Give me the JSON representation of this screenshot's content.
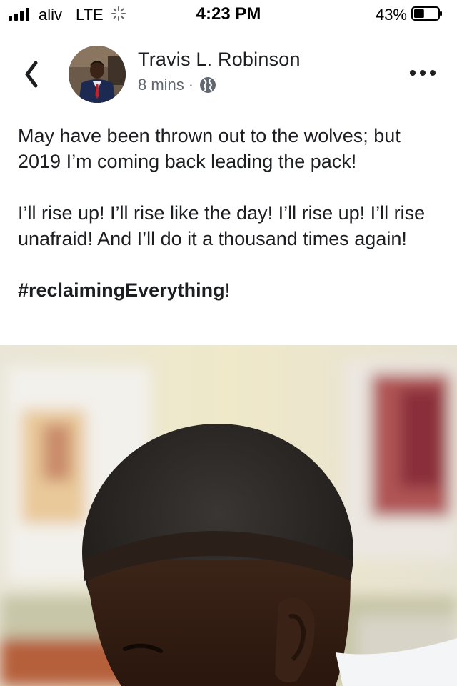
{
  "status_bar": {
    "carrier": "aliv",
    "network": "LTE",
    "time": "4:23 PM",
    "battery_percent": "43%",
    "battery_level": 0.43,
    "icons": [
      "signal-bars-icon",
      "loading-spinner-icon",
      "battery-icon"
    ]
  },
  "post": {
    "author": "Travis L. Robinson",
    "timestamp": "8 mins",
    "separator": "·",
    "privacy_icon": "globe-icon",
    "header_icons": [
      "back-chevron-icon",
      "more-dots-icon"
    ],
    "paragraphs": [
      "May have been thrown out to the wolves; but 2019 I’m coming back leading the pack!",
      "I’ll rise up! I’ll rise like the day! I’ll rise up! I’ll rise unafraid! And I’ll do it a thousand times again!"
    ],
    "hashtag": "#reclaimingEverything",
    "hashtag_tail": "!",
    "photo_description_icon": "photo-image"
  },
  "colors": {
    "text": "#1c1e21",
    "secondary_text": "#606770",
    "background": "#ffffff"
  }
}
